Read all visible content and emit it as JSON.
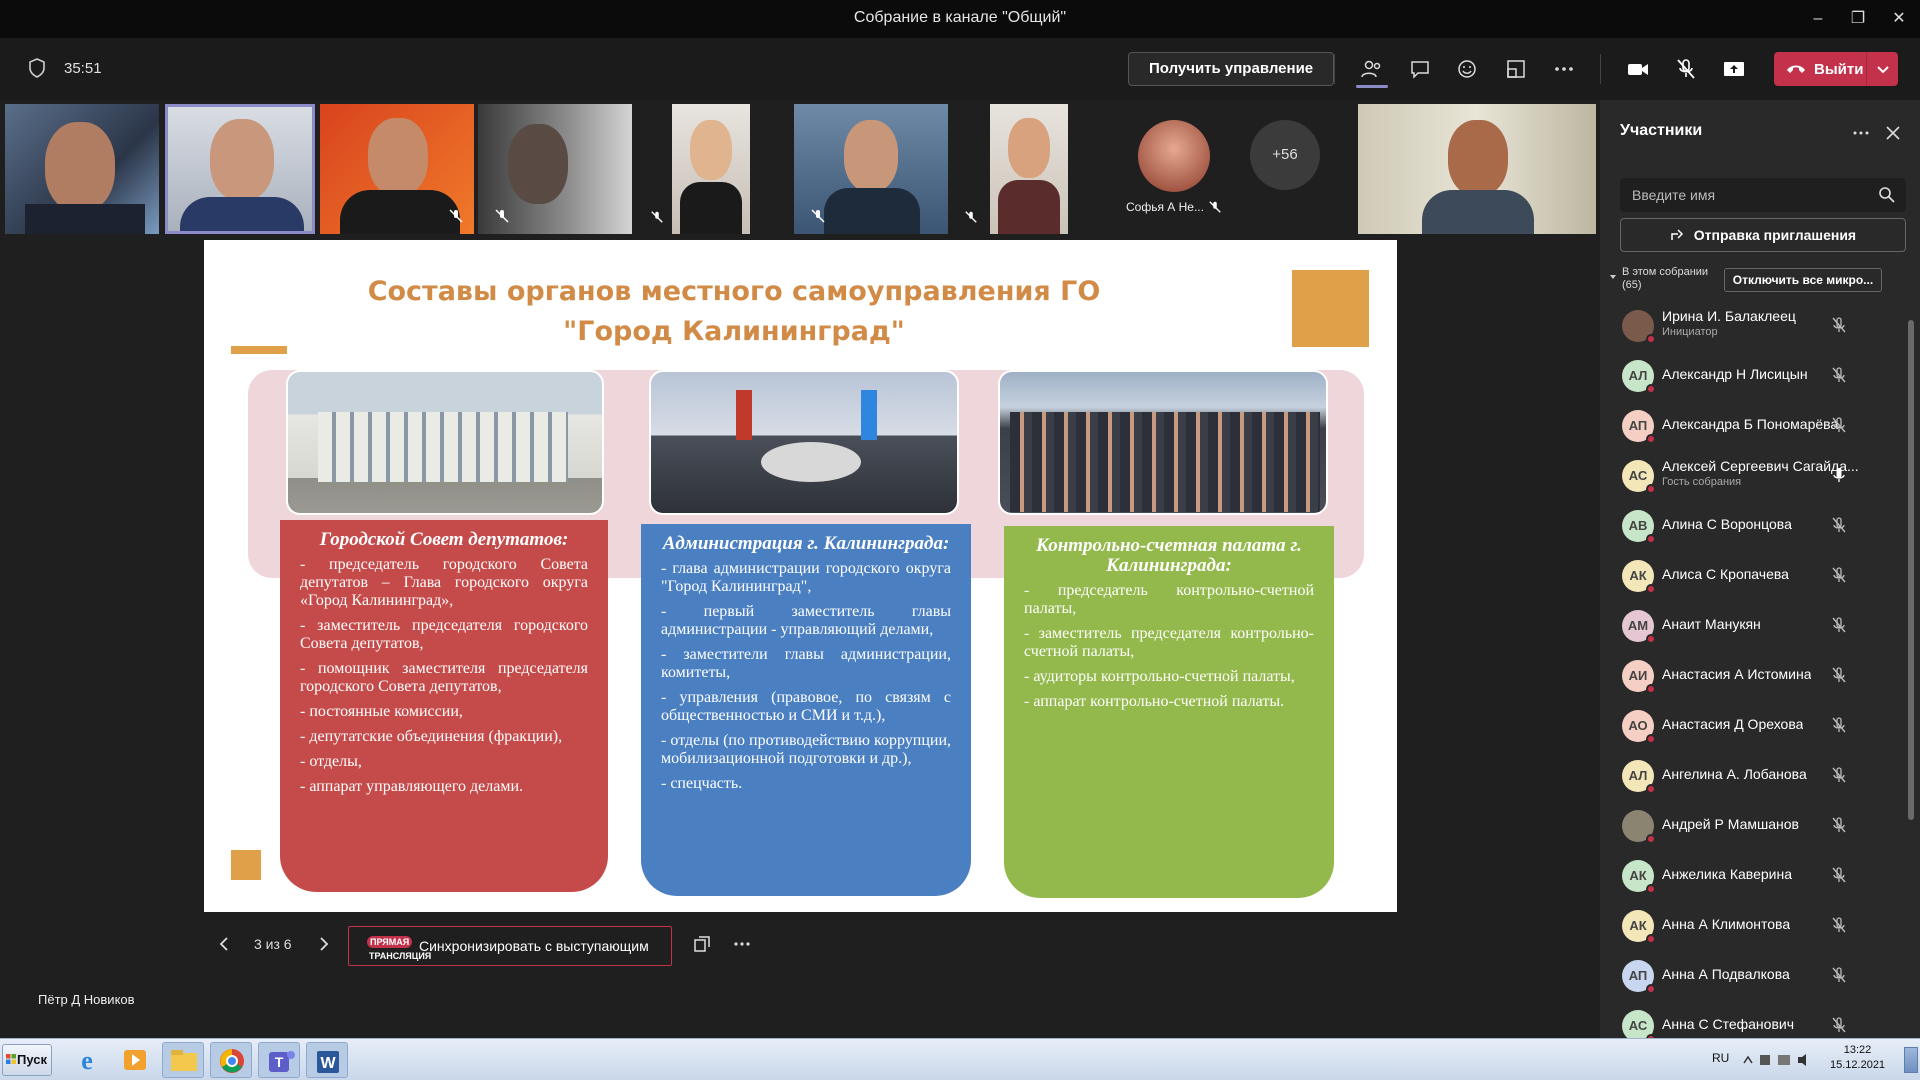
{
  "window": {
    "title": "Собрание в канале \"Общий\""
  },
  "toolbar": {
    "timer": "35:51",
    "take_control_label": "Получить управление",
    "leave_label": "Выйти"
  },
  "strip": {
    "more_count": "+56",
    "featured_name": "Софья А Не..."
  },
  "slide": {
    "title_line1": "Составы органов местного самоуправления ГО",
    "title_line2": "\"Город Калининград\"",
    "cards": [
      {
        "heading": "Городской Совет депутатов:",
        "items": [
          "- председатель городского Совета депутатов – Глава городского округа «Город Калининград»,",
          "- заместитель председателя городского Совета депутатов,",
          "- помощник заместителя председателя городского Совета депутатов,",
          "- постоянные комиссии,",
          "- депутатские объединения (фракции),",
          "- отделы,",
          "- аппарат управляющего делами."
        ]
      },
      {
        "heading": "Администрация г. Калининграда:",
        "items": [
          "- глава администрации городского округа \"Город Калининград\",",
          "- первый заместитель главы администрации - управляющий делами,",
          "- заместители главы администрации, комитеты,",
          "- управления (правовое, по связям с общественностью и СМИ и т.д.),",
          "- отделы (по противодействию коррупции, мобилизационной подготовки и др.),",
          "- спецчасть."
        ]
      },
      {
        "heading": "Контрольно-счетная палата г. Калининграда:",
        "items": [
          "- председатель контрольно-счетной палаты,",
          "- заместитель председателя контрольно-счетной палаты,",
          "- аудиторы контрольно-счетной палаты,",
          "- аппарат контрольно-счетной палаты."
        ]
      }
    ]
  },
  "slide_controls": {
    "page": "3 из 6",
    "live_badge": "ПРЯМАЯ",
    "live_sub": "ТРАНСЛЯЦИЯ",
    "sync_label": "Синхронизировать с выступающим"
  },
  "presenter_name": "Пётр Д Новиков",
  "participants": {
    "title": "Участники",
    "search_placeholder": "Введите имя",
    "invite_label": "Отправка приглашения",
    "in_meeting_label": "В этом собрании",
    "in_meeting_count": "(65)",
    "mute_all_label": "Отключить все микро...",
    "list": [
      {
        "initials": "",
        "name": "Ирина И. Балаклеец",
        "role": "Инициатор",
        "avatar_color": "#7a5a4a",
        "mic": "muted"
      },
      {
        "initials": "АЛ",
        "name": "Александр Н Лисицын",
        "role": "",
        "avatar_color": "#c7e6c9",
        "mic": "muted"
      },
      {
        "initials": "АП",
        "name": "Александра Б Пономарёва",
        "role": "",
        "avatar_color": "#f6cfc4",
        "mic": "muted"
      },
      {
        "initials": "АС",
        "name": "Алексей Сергеевич Сагайда...",
        "role": "Гость собрания",
        "avatar_color": "#f3e6b8",
        "mic": "on"
      },
      {
        "initials": "АВ",
        "name": "Алина С Воронцова",
        "role": "",
        "avatar_color": "#c7e6c9",
        "mic": "muted"
      },
      {
        "initials": "АК",
        "name": "Алиса С Кропачева",
        "role": "",
        "avatar_color": "#f3e6b8",
        "mic": "muted"
      },
      {
        "initials": "АМ",
        "name": "Анаит Манукян",
        "role": "",
        "avatar_color": "#e4c7d2",
        "mic": "muted"
      },
      {
        "initials": "АИ",
        "name": "Анастасия А Истомина",
        "role": "",
        "avatar_color": "#f6cfc4",
        "mic": "muted"
      },
      {
        "initials": "АО",
        "name": "Анастасия Д Орехова",
        "role": "",
        "avatar_color": "#f6cfc4",
        "mic": "muted"
      },
      {
        "initials": "АЛ",
        "name": "Ангелина А. Лобанова",
        "role": "",
        "avatar_color": "#f3e6b8",
        "mic": "muted"
      },
      {
        "initials": "",
        "name": "Андрей Р Мамшанов",
        "role": "",
        "avatar_color": "#8a8470",
        "mic": "muted"
      },
      {
        "initials": "АК",
        "name": "Анжелика Каверина",
        "role": "",
        "avatar_color": "#c7e6c9",
        "mic": "muted"
      },
      {
        "initials": "АК",
        "name": "Анна А Климонтова",
        "role": "",
        "avatar_color": "#f3e6b8",
        "mic": "muted"
      },
      {
        "initials": "АП",
        "name": "Анна А Подвалкова",
        "role": "",
        "avatar_color": "#c9d6f0",
        "mic": "muted"
      },
      {
        "initials": "АС",
        "name": "Анна С Стефанович",
        "role": "",
        "avatar_color": "#c7e6c9",
        "mic": "muted"
      }
    ]
  },
  "taskbar": {
    "start_label": "Пуск",
    "lang": "RU",
    "time": "13:22",
    "date": "15.12.2021"
  }
}
